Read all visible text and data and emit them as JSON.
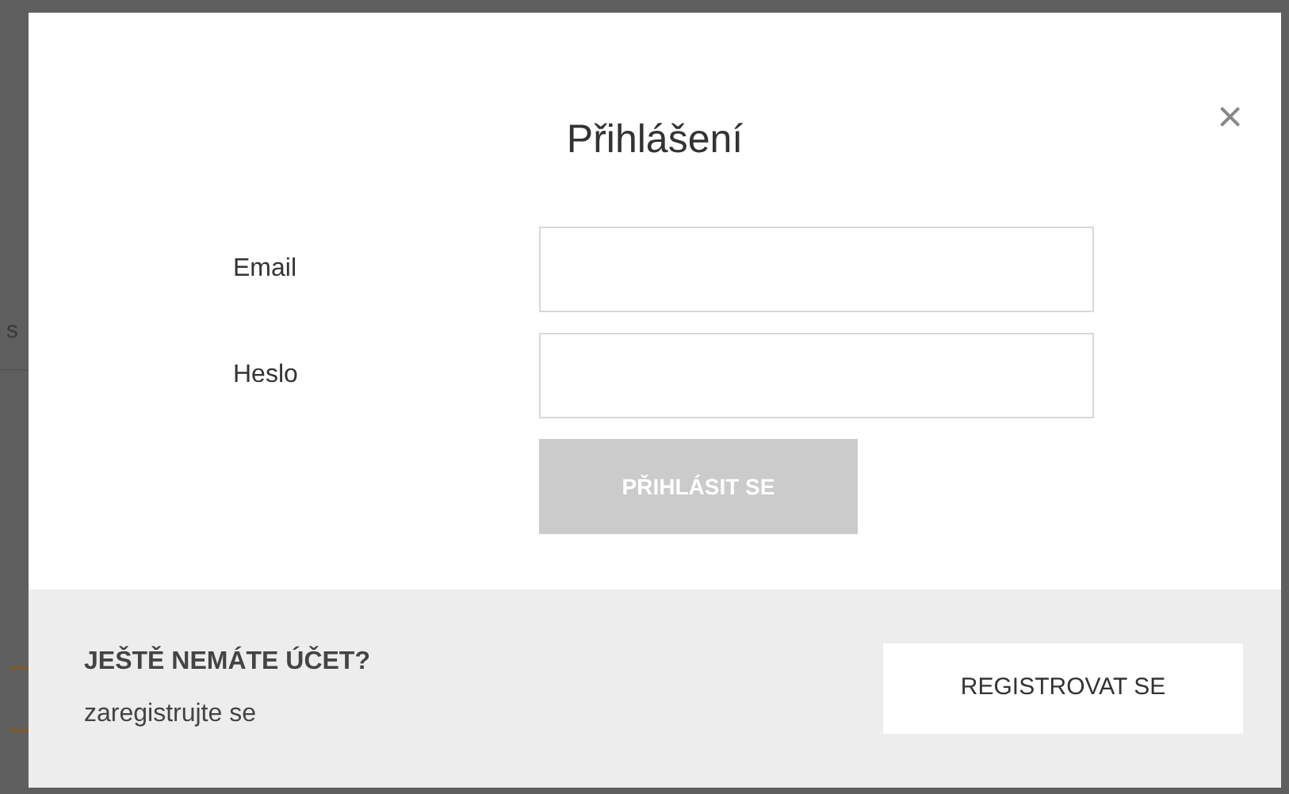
{
  "background": {
    "text_fragment": "s"
  },
  "dialog": {
    "title": "Přihlášení",
    "close": "×",
    "fields": [
      {
        "label": "Email"
      },
      {
        "label": "Heslo"
      }
    ],
    "submit": {
      "label": "PŘIHLÁSIT SE",
      "disabled": true
    },
    "footer": {
      "heading": "JEŠTĚ NEMÁTE ÚČET?",
      "subtext": "zaregistrujte se",
      "button": "REGISTROVAT SE"
    }
  }
}
